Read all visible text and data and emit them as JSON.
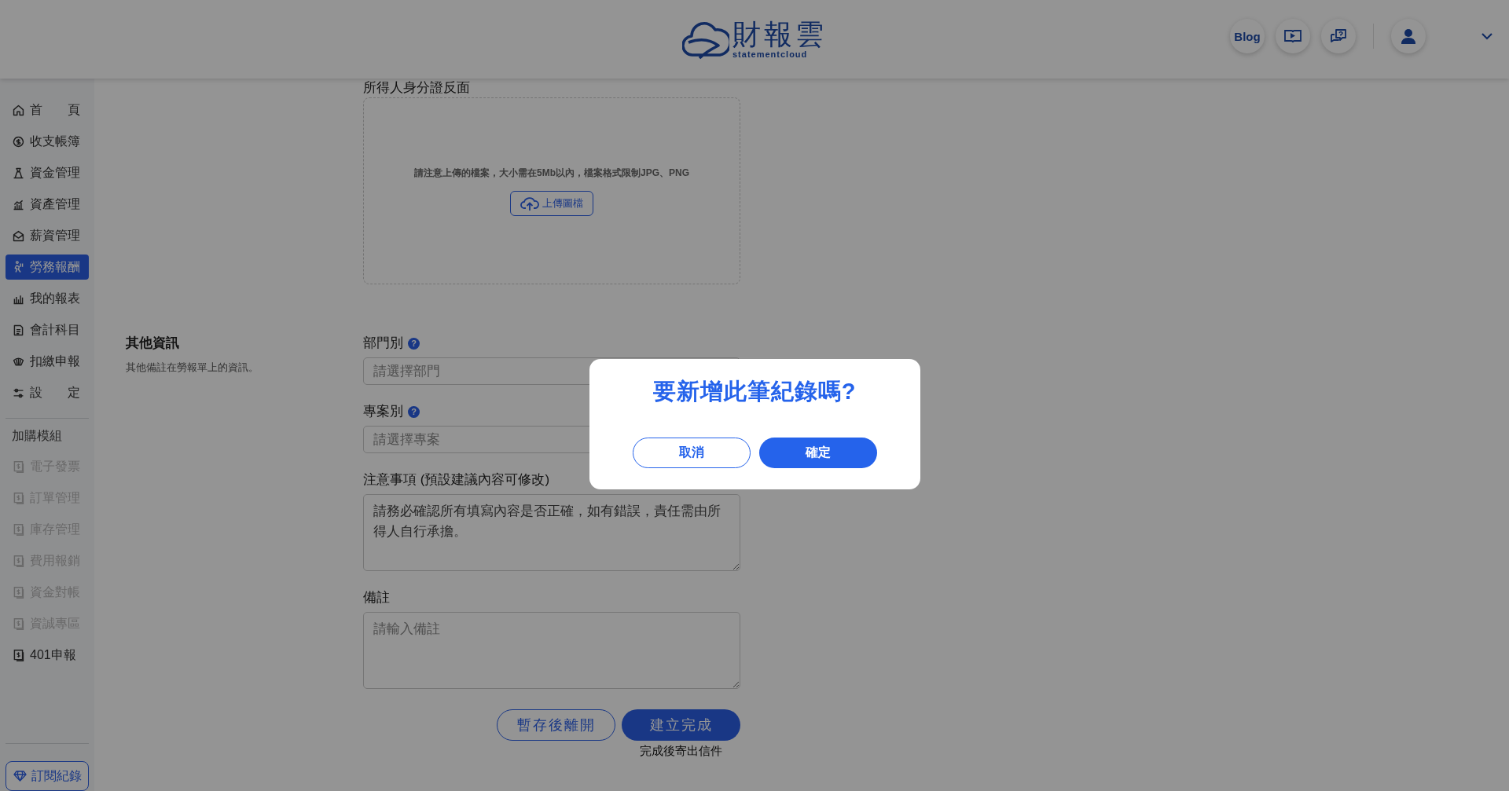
{
  "header": {
    "logo": {
      "name": "財報雲",
      "tagline": "statementcloud"
    },
    "blog_button": "Blog"
  },
  "sidebar": {
    "items": [
      {
        "label": "首　　頁",
        "selected": false,
        "disabled": false
      },
      {
        "label": "收支帳簿",
        "selected": false,
        "disabled": false
      },
      {
        "label": "資金管理",
        "selected": false,
        "disabled": false
      },
      {
        "label": "資產管理",
        "selected": false,
        "disabled": false
      },
      {
        "label": "薪資管理",
        "selected": false,
        "disabled": false
      },
      {
        "label": "勞務報酬",
        "selected": true,
        "disabled": false
      },
      {
        "label": "我的報表",
        "selected": false,
        "disabled": false
      },
      {
        "label": "會計科目",
        "selected": false,
        "disabled": false
      },
      {
        "label": "扣繳申報",
        "selected": false,
        "disabled": false
      },
      {
        "label": "設　　定",
        "selected": false,
        "disabled": false
      }
    ],
    "addons_title": "加購模組",
    "addons": [
      {
        "label": "電子發票",
        "selected": false,
        "disabled": true
      },
      {
        "label": "訂單管理",
        "selected": false,
        "disabled": true
      },
      {
        "label": "庫存管理",
        "selected": false,
        "disabled": true
      },
      {
        "label": "費用報銷",
        "selected": false,
        "disabled": true
      },
      {
        "label": "資金對帳",
        "selected": false,
        "disabled": true
      },
      {
        "label": "資誠專區",
        "selected": false,
        "disabled": true
      },
      {
        "label": "401申報",
        "selected": false,
        "disabled": false
      }
    ],
    "subscription_button": "訂閱紀錄"
  },
  "form": {
    "upload": {
      "label": "所得人身分證反面",
      "hint": "請注意上傳的檔案，大小需在5Mb以內，檔案格式限制JPG、PNG",
      "button": "上傳圖檔"
    },
    "section": {
      "title": "其他資訊",
      "description": "其他備註在勞報單上的資訊。"
    },
    "fields": [
      {
        "kind": "select",
        "label": "部門別",
        "help": "?",
        "placeholder": "請選擇部門"
      },
      {
        "kind": "select",
        "label": "專案別",
        "help": "?",
        "placeholder": "請選擇專案"
      },
      {
        "kind": "textarea",
        "label": "注意事項 (預設建議內容可修改)",
        "value": "請務必確認所有填寫內容是否正確，如有錯誤，責任需由所得人自行承擔。"
      },
      {
        "kind": "textarea",
        "label": "備註",
        "placeholder": "請輸入備註"
      }
    ],
    "save_draft_button": "暫存後離開",
    "submit_button": "建立完成",
    "submit_note": "完成後寄出信件"
  },
  "dialog": {
    "title": "要新增此筆紀錄嗎?",
    "cancel_button": "取消",
    "confirm_button": "確定"
  }
}
